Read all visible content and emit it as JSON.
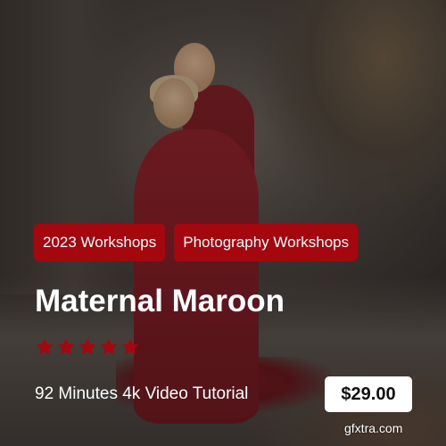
{
  "card": {
    "tags": [
      "2023 Workshops",
      "Photography Workshops"
    ],
    "title": "Maternal Maroon",
    "rating": {
      "stars": 5,
      "max": 5,
      "star_color": "#a4070d"
    },
    "description": "92 Minutes 4k Video Tutorial",
    "price": "$29.00"
  },
  "colors": {
    "tag_background": "#a4070d",
    "price_background": "#ffffff"
  },
  "watermark": {
    "text": "gfxtra.com"
  }
}
